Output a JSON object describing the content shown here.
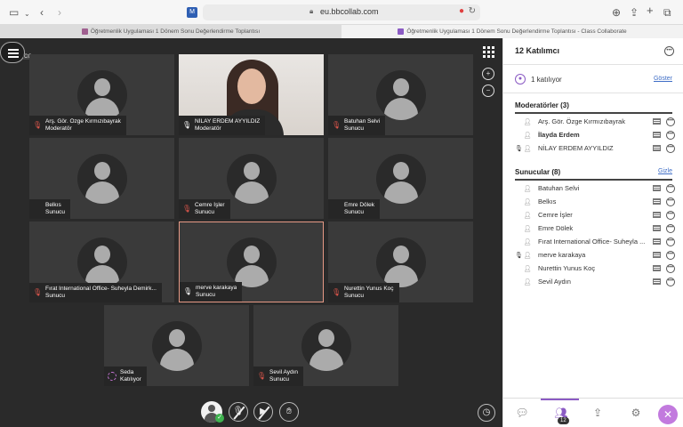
{
  "browser": {
    "url": "eu.bbcollab.com",
    "favicon_letter": "M",
    "tabs": [
      {
        "title": "Öğretmenlik Uygulaması 1 Dönem Sonu Değerlendirme Toplantısı",
        "active": true
      },
      {
        "title": "Öğretmenlik Uygulaması 1 Dönem Sonu Değerlendirme Toplantısı - Class Collaborate",
        "active": false
      }
    ],
    "cc_label": "CC"
  },
  "tiles": [
    {
      "name": "Arş. Gör. Özge Kırmızıbayrak",
      "role": "Moderatör",
      "status": "muted",
      "video": false,
      "active": false
    },
    {
      "name": "NİLAY ERDEM AYYILDIZ",
      "role": "Moderatör",
      "status": "live",
      "video": true,
      "active": false
    },
    {
      "name": "Batuhan Selvi",
      "role": "Sunucu",
      "status": "muted",
      "video": false,
      "active": false
    },
    {
      "name": "Belkıs",
      "role": "Sunucu",
      "status": "none",
      "video": false,
      "active": false
    },
    {
      "name": "Cemre İşler",
      "role": "Sunucu",
      "status": "muted",
      "video": false,
      "active": false
    },
    {
      "name": "Emre Dölek",
      "role": "Sunucu",
      "status": "none",
      "video": false,
      "active": false
    },
    {
      "name": "Fırat International Office- Suheyla Demirk...",
      "role": "Sunucu",
      "status": "muted",
      "video": false,
      "active": false
    },
    {
      "name": "merve karakaya",
      "role": "Sunucu",
      "status": "live",
      "video": false,
      "active": true
    },
    {
      "name": "Nurettin Yunus Koç",
      "role": "Sunucu",
      "status": "muted",
      "video": false,
      "active": false
    },
    {
      "name": "Seda",
      "role": "Katılıyor",
      "status": "joining",
      "video": false,
      "active": false
    },
    {
      "name": "Sevil Aydın",
      "role": "Sunucu",
      "status": "muted",
      "video": false,
      "active": false
    }
  ],
  "panel": {
    "title": "12 Katılımcı",
    "joining_text": "1 katılıyor",
    "show_link": "Göster",
    "moderators_header": "Moderatörler (3)",
    "moderators": [
      {
        "name": "Arş. Gör. Özge Kırmızıbayrak",
        "bold": false,
        "talking": false
      },
      {
        "name": "İlayda Erdem",
        "bold": true,
        "talking": false
      },
      {
        "name": "NİLAY ERDEM AYYILDIZ",
        "bold": false,
        "talking": true
      }
    ],
    "presenters_header": "Sunucular (8)",
    "hide_link": "Gizle",
    "presenters": [
      {
        "name": "Batuhan Selvi",
        "talking": false
      },
      {
        "name": "Belkıs",
        "talking": false
      },
      {
        "name": "Cemre İşler",
        "talking": false
      },
      {
        "name": "Emre Dölek",
        "talking": false
      },
      {
        "name": "Fırat International Office- Suheyla ...",
        "talking": false
      },
      {
        "name": "merve karakaya",
        "talking": true
      },
      {
        "name": "Nurettin Yunus Koç",
        "talking": false
      },
      {
        "name": "Sevil Aydın",
        "talking": false
      }
    ],
    "participant_count_badge": "12"
  },
  "colors": {
    "accent": "#8b5bc4",
    "muted_icon": "#e2574c",
    "active_tile_border": "#e79a86",
    "close_button": "#c27ade"
  }
}
